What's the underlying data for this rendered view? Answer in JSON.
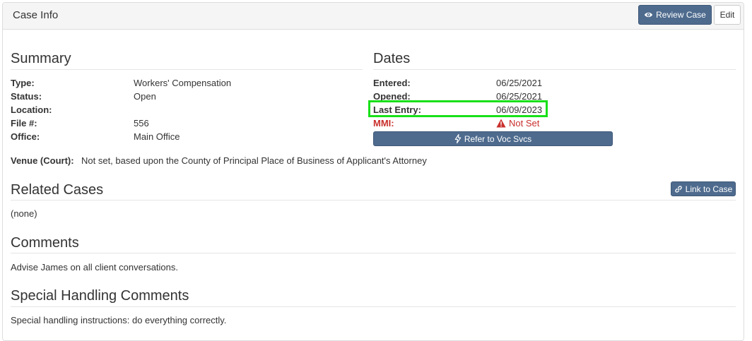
{
  "header": {
    "title": "Case Info",
    "review_label": "Review Case",
    "edit_label": "Edit"
  },
  "summary": {
    "title": "Summary",
    "rows": [
      {
        "label": "Type:",
        "value": "Workers' Compensation"
      },
      {
        "label": "Status:",
        "value": "Open"
      },
      {
        "label": "Location:",
        "value": ""
      },
      {
        "label": "File #:",
        "value": "556"
      },
      {
        "label": "Office:",
        "value": "Main Office"
      }
    ],
    "venue_label": "Venue (Court):",
    "venue_value": "Not set, based upon the County of Principal Place of Business of Applicant's Attorney"
  },
  "dates": {
    "title": "Dates",
    "rows": [
      {
        "label": "Entered:",
        "value": "06/25/2021"
      },
      {
        "label": "Opened:",
        "value": "06/25/2021"
      },
      {
        "label": "Last Entry:",
        "value": "06/09/2023"
      },
      {
        "label": "MMI:",
        "value": "Not Set"
      }
    ],
    "refer_label": "Refer to Voc Svcs"
  },
  "related": {
    "title": "Related Cases",
    "link_label": "Link to Case",
    "value": "(none)"
  },
  "comments": {
    "title": "Comments",
    "value": "Advise James on all client conversations."
  },
  "special": {
    "title": "Special Handling Comments",
    "value": "Special handling instructions: do everything correctly."
  },
  "colors": {
    "primary": "#4e6b8e",
    "warning": "#c9302c",
    "highlight": "#19e019"
  }
}
